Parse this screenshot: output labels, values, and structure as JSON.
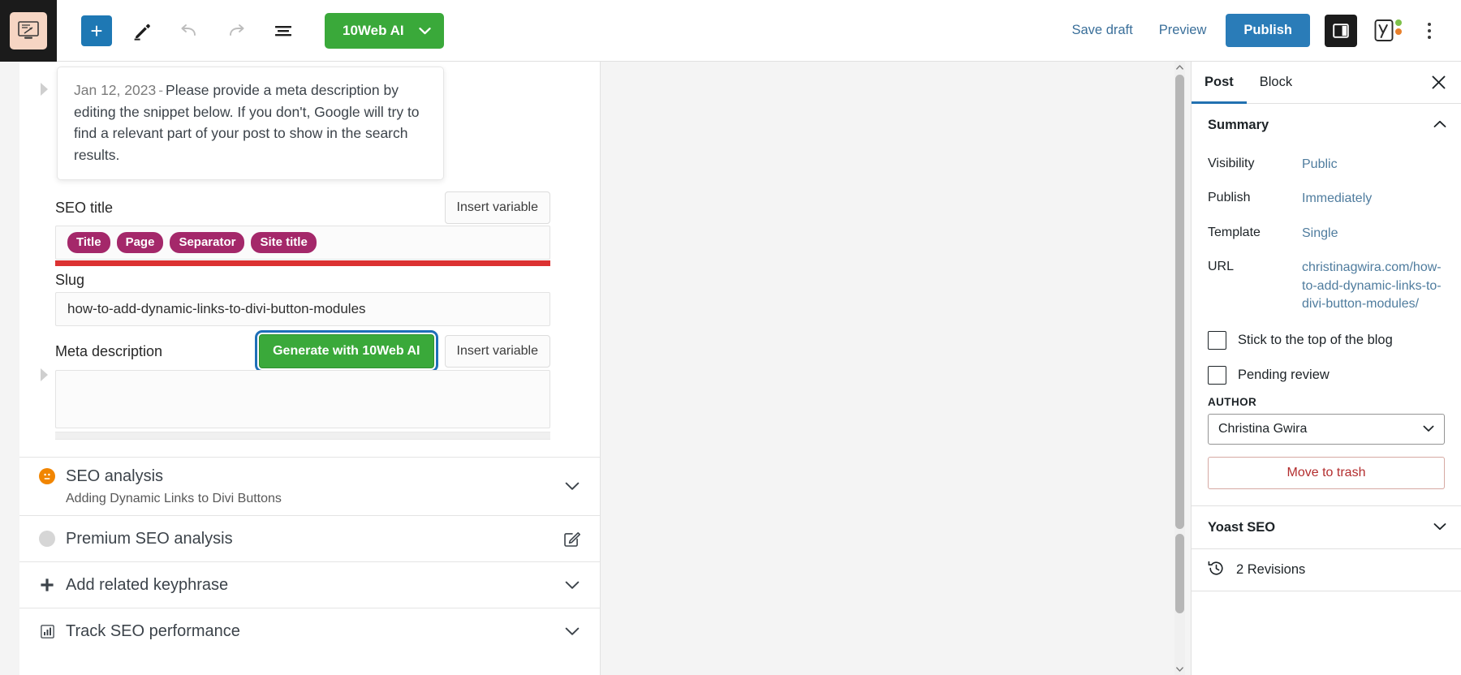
{
  "toolbar": {
    "logo_icon": "wordpress-site-icon",
    "add_block_label": "+",
    "add_block_icon": "plus-icon",
    "tools_icon": "pencil-icon",
    "undo_icon": "undo-arrow-icon",
    "redo_icon": "redo-arrow-icon",
    "list_view_icon": "document-outline-icon",
    "tenweb_label": "10Web AI",
    "tenweb_chevron_icon": "chevron-down-icon",
    "save_draft_label": "Save draft",
    "preview_label": "Preview",
    "publish_label": "Publish",
    "sidebar_toggle_icon": "settings-panel-icon",
    "yoast_icon": "yoast-logo-icon",
    "options_icon": "kebab-menu-icon",
    "accent_blue": "#2a7cb8",
    "accent_green": "#3aa93a"
  },
  "yoast_panel": {
    "snippet_help": {
      "date": "Jan 12, 2023",
      "dash": "-",
      "text": "Please provide a meta description by editing the snippet below. If you don't, Google will try to find a relevant part of your post to show in the search results."
    },
    "seo_title": {
      "label": "SEO title",
      "insert_variable_label": "Insert variable",
      "variables": [
        "Title",
        "Page",
        "Separator",
        "Site title"
      ],
      "pill_color": "#a4286a",
      "progress_color": "#dc3232"
    },
    "slug": {
      "label": "Slug",
      "value": "how-to-add-dynamic-links-to-divi-button-modules"
    },
    "meta_description": {
      "label": "Meta description",
      "generate_label": "Generate with 10Web AI",
      "insert_variable_label": "Insert variable",
      "value": ""
    },
    "accordions": [
      {
        "title": "SEO analysis",
        "subtitle": "Adding Dynamic Links to Divi Buttons",
        "bullet": "orange-neutral-face-icon",
        "trailing_icon": "chevron-down-icon"
      },
      {
        "title": "Premium SEO analysis",
        "subtitle": "",
        "bullet": "grey-circle-icon",
        "trailing_icon": "edit-pencil-square-icon"
      },
      {
        "title": "Add related keyphrase",
        "subtitle": "",
        "bullet": "plus-icon",
        "trailing_icon": "chevron-down-icon"
      },
      {
        "title": "Track SEO performance",
        "subtitle": "",
        "bullet": "chart-bar-icon",
        "trailing_icon": "chevron-down-icon"
      }
    ]
  },
  "sidebar": {
    "tabs": [
      {
        "label": "Post",
        "active": true
      },
      {
        "label": "Block",
        "active": false
      }
    ],
    "close_icon": "close-x-icon",
    "summary": {
      "title": "Summary",
      "toggle_icon": "chevron-up-icon",
      "rows": [
        {
          "label": "Visibility",
          "value": "Public"
        },
        {
          "label": "Publish",
          "value": "Immediately"
        },
        {
          "label": "Template",
          "value": "Single"
        },
        {
          "label": "URL",
          "value": "christinagwira.com/how-to-add-dynamic-links-to-divi-button-modules/"
        }
      ],
      "checkboxes": [
        {
          "label": "Stick to the top of the blog",
          "checked": false
        },
        {
          "label": "Pending review",
          "checked": false
        }
      ],
      "author_label": "AUTHOR",
      "author_value": "Christina Gwira",
      "author_chevron_icon": "chevron-down-icon",
      "trash_label": "Move to trash",
      "trash_color": "#b32d2e"
    },
    "yoast_section": {
      "title": "Yoast SEO",
      "toggle_icon": "chevron-down-icon"
    },
    "revisions": {
      "label": "2 Revisions",
      "icon": "clock-revision-icon"
    }
  }
}
